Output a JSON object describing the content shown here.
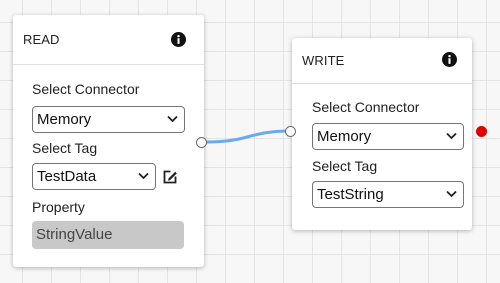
{
  "read_node": {
    "title": "READ",
    "connector_label": "Select Connector",
    "connector_value": "Memory",
    "tag_label": "Select Tag",
    "tag_value": "TestData",
    "property_label": "Property",
    "property_value": "StringValue"
  },
  "write_node": {
    "title": "WRITE",
    "connector_label": "Select Connector",
    "connector_value": "Memory",
    "tag_label": "Select Tag",
    "tag_value": "TestString"
  },
  "icons": {
    "info": "info-icon",
    "edit": "edit-icon",
    "dropdown": "chevron-down-icon"
  },
  "colors": {
    "wire": "#6aaaf0",
    "error_port": "#e10000"
  }
}
